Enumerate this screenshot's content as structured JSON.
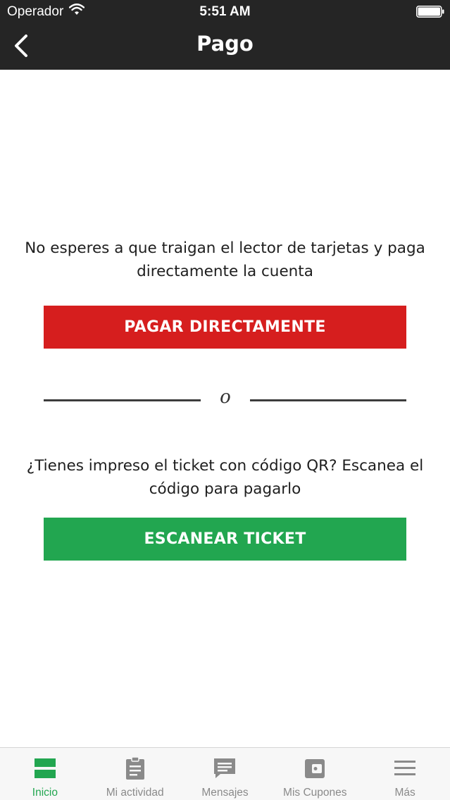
{
  "status_bar": {
    "carrier": "Operador",
    "time": "5:51 AM"
  },
  "nav": {
    "title": "Pago"
  },
  "main": {
    "pay_prompt": "No esperes a que traigan el lector de tarjetas y paga directamente la cuenta",
    "pay_button": "PAGAR DIRECTAMENTE",
    "divider_text": "o",
    "scan_prompt": "¿Tienes impreso el ticket con código QR? Escanea el código para pagarlo",
    "scan_button": "ESCANEAR TICKET"
  },
  "tabs": [
    {
      "label": "Inicio",
      "icon": "home-icon",
      "active": true
    },
    {
      "label": "Mi actividad",
      "icon": "clipboard-icon",
      "active": false
    },
    {
      "label": "Mensajes",
      "icon": "message-icon",
      "active": false
    },
    {
      "label": "Mis Cupones",
      "icon": "wallet-icon",
      "active": false
    },
    {
      "label": "Más",
      "icon": "menu-icon",
      "active": false
    }
  ],
  "colors": {
    "bar_background": "#252525",
    "pay_button": "#d61e1e",
    "scan_button": "#22a650",
    "tab_active": "#22a650",
    "tab_inactive": "#8a8a8a"
  }
}
